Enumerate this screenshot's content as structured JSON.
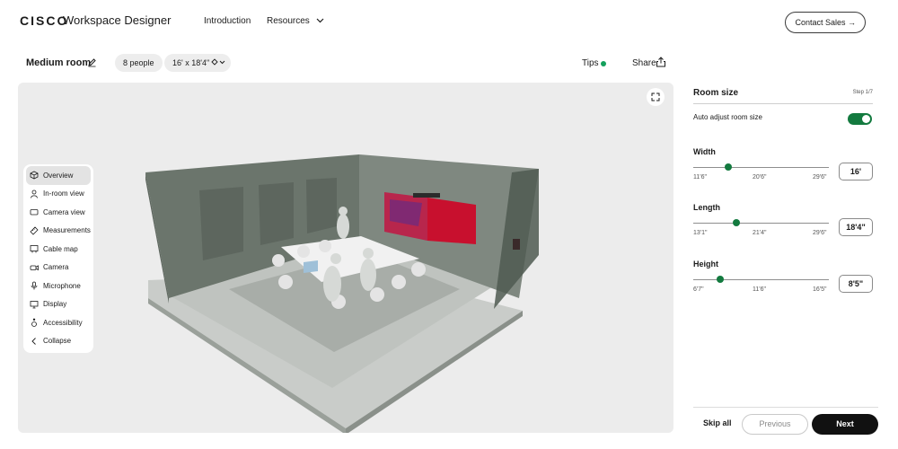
{
  "header": {
    "logo": "CISCO",
    "product": "Workspace Designer",
    "nav": [
      {
        "label": "Introduction"
      },
      {
        "label": "Resources"
      }
    ],
    "contact_label": "Contact Sales →"
  },
  "room": {
    "name": "Medium room",
    "people": "8 people",
    "dimensions": "16' x 18'4\"",
    "tips_label": "Tips",
    "share_label": "Share"
  },
  "view_menu": {
    "items": [
      {
        "label": "Overview",
        "icon": "overview-icon",
        "active": true
      },
      {
        "label": "In-room view",
        "icon": "person-icon"
      },
      {
        "label": "Camera view",
        "icon": "camera-view-icon"
      },
      {
        "label": "Measurements",
        "icon": "ruler-icon"
      },
      {
        "label": "Cable map",
        "icon": "cable-icon"
      },
      {
        "label": "Camera",
        "icon": "camera-icon"
      },
      {
        "label": "Microphone",
        "icon": "microphone-icon"
      },
      {
        "label": "Display",
        "icon": "display-icon"
      },
      {
        "label": "Accessibility",
        "icon": "accessibility-icon"
      },
      {
        "label": "Collapse",
        "icon": "chevron-left-icon"
      }
    ]
  },
  "panel": {
    "title": "Room size",
    "step": "Step 1/7",
    "auto_adjust_label": "Auto adjust room size",
    "auto_adjust_on": true,
    "width": {
      "label": "Width",
      "ticks": [
        "11'6\"",
        "20'6\"",
        "29'6\""
      ],
      "value": "16'",
      "fraction": 0.26
    },
    "length": {
      "label": "Length",
      "ticks": [
        "13'1\"",
        "21'4\"",
        "29'6\""
      ],
      "value": "18'4\"",
      "fraction": 0.32
    },
    "height": {
      "label": "Height",
      "ticks": [
        "6'7\"",
        "11'6\"",
        "16'5\""
      ],
      "value": "8'5\"",
      "fraction": 0.2
    },
    "skip_label": "Skip all",
    "previous_label": "Previous",
    "next_label": "Next"
  },
  "colors": {
    "accent_green": "#137a3f",
    "tips_dot": "#14a05c",
    "wall": "#6b756c",
    "next_button": "#111111"
  }
}
